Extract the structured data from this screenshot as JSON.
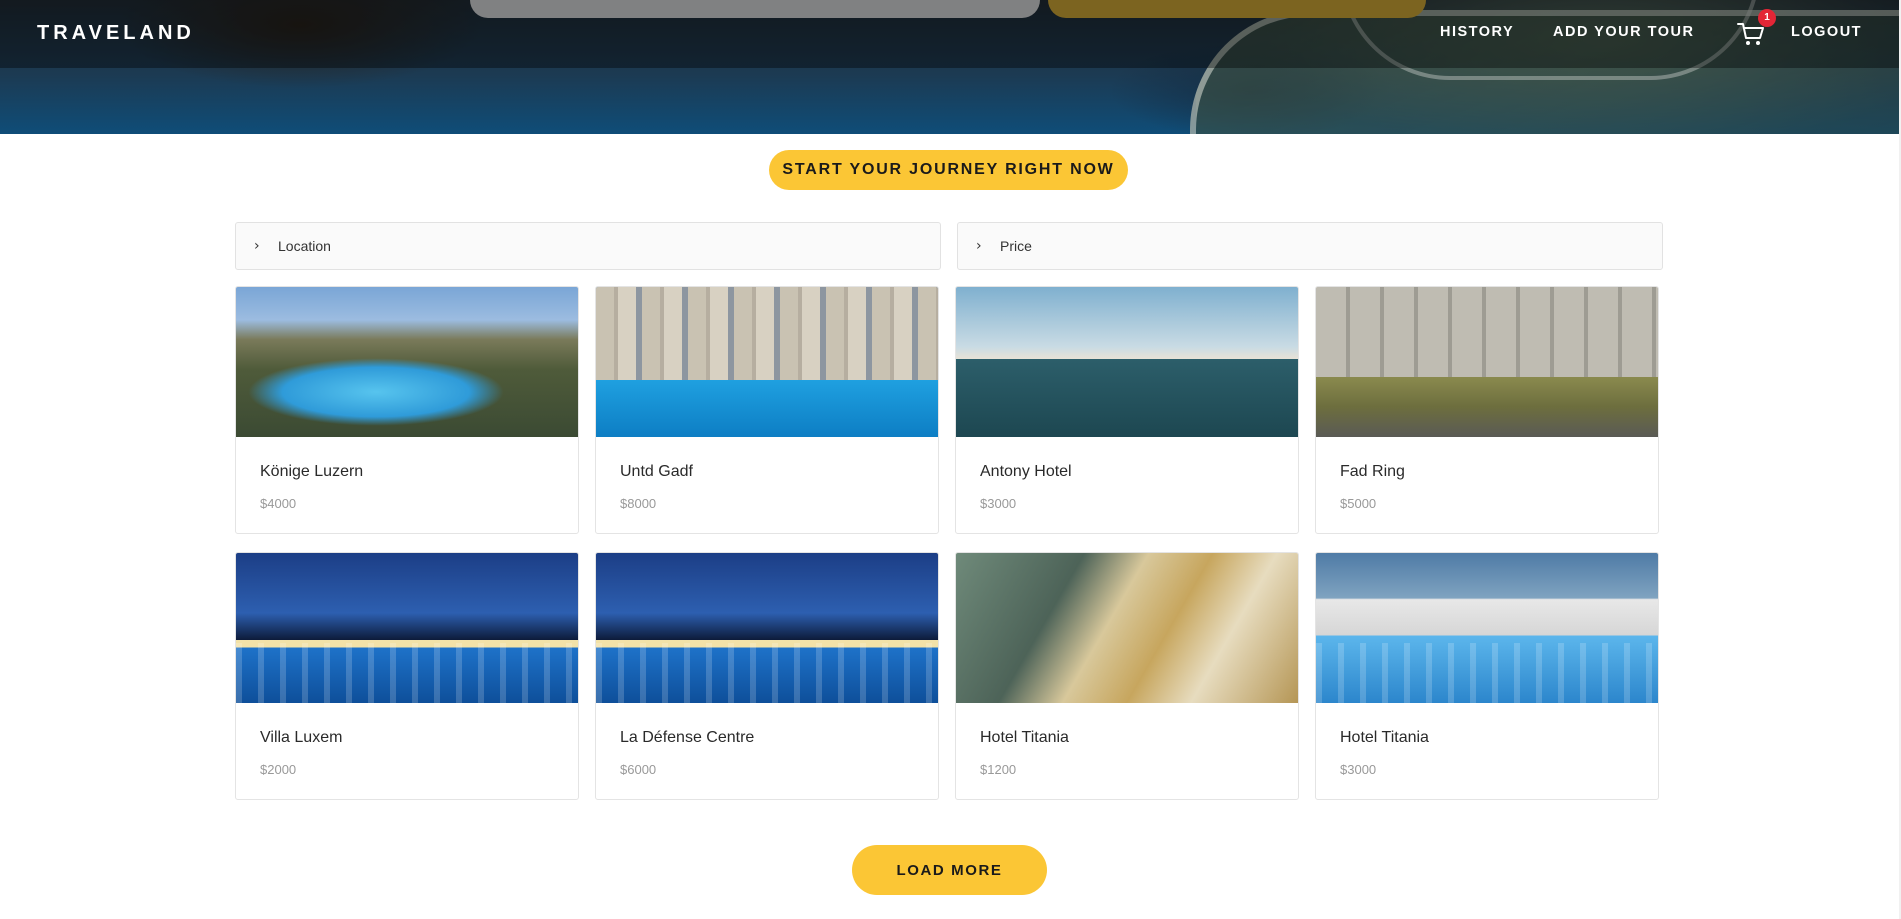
{
  "header": {
    "brand": "TRAVELAND",
    "nav": {
      "history": "HISTORY",
      "add_tour": "ADD YOUR TOUR",
      "cart_count": "1",
      "logout": "LOGOUT"
    }
  },
  "hero": {
    "cta_label": "START YOUR JOURNEY RIGHT NOW"
  },
  "filters": {
    "location": "Location",
    "price": "Price"
  },
  "listings": [
    {
      "name": "Könige Luzern",
      "price": "$4000"
    },
    {
      "name": "Untd Gadf",
      "price": "$8000"
    },
    {
      "name": "Antony Hotel",
      "price": "$3000"
    },
    {
      "name": "Fad Ring",
      "price": "$5000"
    },
    {
      "name": "Villa Luxem",
      "price": "$2000"
    },
    {
      "name": "La Défense Centre",
      "price": "$6000"
    },
    {
      "name": "Hotel Titania",
      "price": "$1200"
    },
    {
      "name": "Hotel Titania",
      "price": "$3000"
    }
  ],
  "footer": {
    "load_more": "LOAD MORE"
  },
  "colors": {
    "accent": "#fbc635",
    "badge": "#e32636",
    "navbar_overlay": "rgba(0,0,0,0.38)"
  },
  "icons": {
    "cart": "cart-icon",
    "chevron": "chevron-right-icon"
  }
}
